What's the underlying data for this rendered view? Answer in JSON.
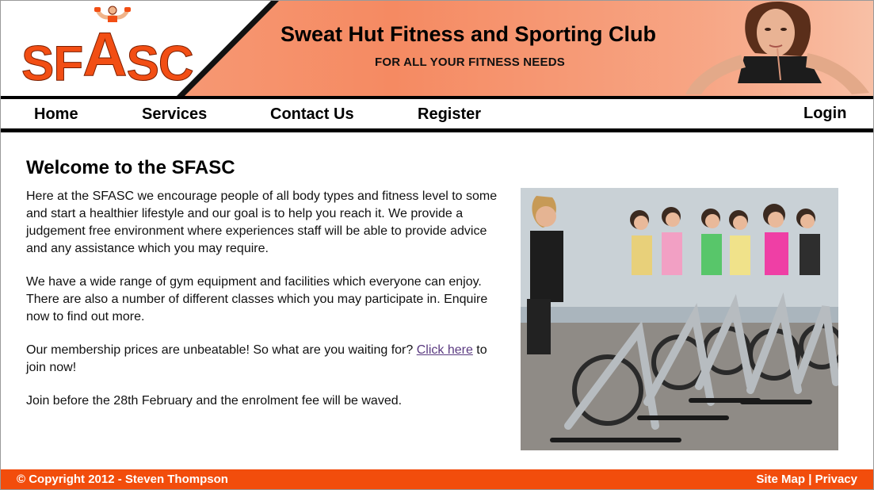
{
  "header": {
    "logo_text": "SFASC",
    "title": "Sweat Hut Fitness and Sporting Club",
    "tagline": "FOR ALL YOUR FITNESS NEEDS"
  },
  "nav": {
    "items": [
      {
        "label": "Home"
      },
      {
        "label": "Services"
      },
      {
        "label": "Contact Us"
      },
      {
        "label": "Register"
      }
    ],
    "login": "Login"
  },
  "main": {
    "title": "Welcome to the SFASC",
    "paragraphs": {
      "p1": "Here at the SFASC we encourage people of all body types and fitness level to some and start a healthier lifestyle and our goal is to help you reach it. We provide a judgement free environment where experiences staff will be able to provide advice and any assistance which you may require.",
      "p2": "We have a wide range of gym equipment and facilities which everyone can enjoy. There are also a number of different classes which you may participate in. Enquire now to find out more.",
      "p3_before": "Our membership prices are unbeatable! So what are you waiting for? ",
      "p3_link": "Click here",
      "p3_after": " to join now!",
      "p4": "Join before the 28th February and the enrolment fee will be waved."
    }
  },
  "footer": {
    "copyright": "© Copyright 2012 - Steven Thompson",
    "sitemap": "Site Map",
    "separator": "|",
    "privacy": "Privacy"
  },
  "colors": {
    "accent": "#f24d0c",
    "header_orange": "#f58a62",
    "link_visited": "#5a3a80"
  }
}
